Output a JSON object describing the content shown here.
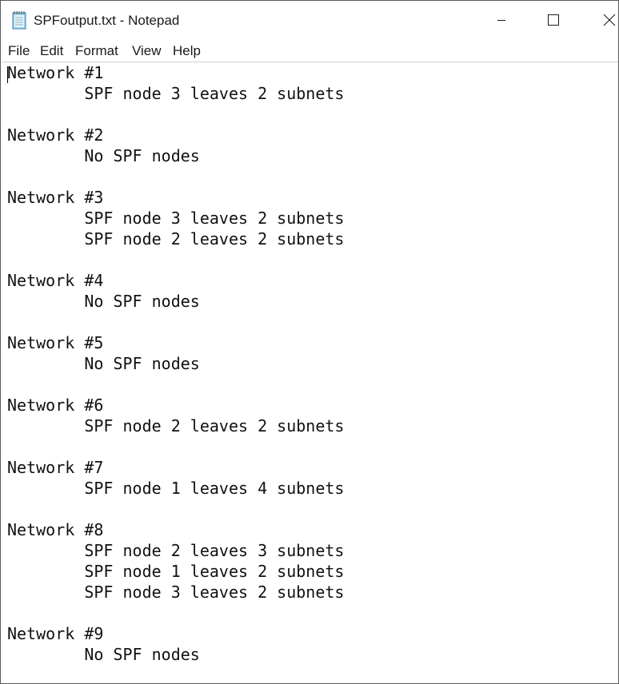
{
  "window": {
    "title": "SPFoutput.txt - Notepad"
  },
  "menu": {
    "items": [
      "File",
      "Edit",
      "Format",
      "View",
      "Help"
    ]
  },
  "document": {
    "content": "Network #1\n\tSPF node 3 leaves 2 subnets\n\nNetwork #2\n\tNo SPF nodes\n\nNetwork #3\n\tSPF node 3 leaves 2 subnets\n\tSPF node 2 leaves 2 subnets\n\nNetwork #4\n\tNo SPF nodes\n\nNetwork #5\n\tNo SPF nodes\n\nNetwork #6\n\tSPF node 2 leaves 2 subnets\n\nNetwork #7\n\tSPF node 1 leaves 4 subnets\n\nNetwork #8\n\tSPF node 2 leaves 3 subnets\n\tSPF node 1 leaves 2 subnets\n\tSPF node 3 leaves 2 subnets\n\nNetwork #9\n\tNo SPF nodes"
  },
  "icons": {
    "app": "notepad-icon",
    "minimize": "minimize-icon",
    "maximize": "maximize-icon",
    "close": "close-icon"
  }
}
